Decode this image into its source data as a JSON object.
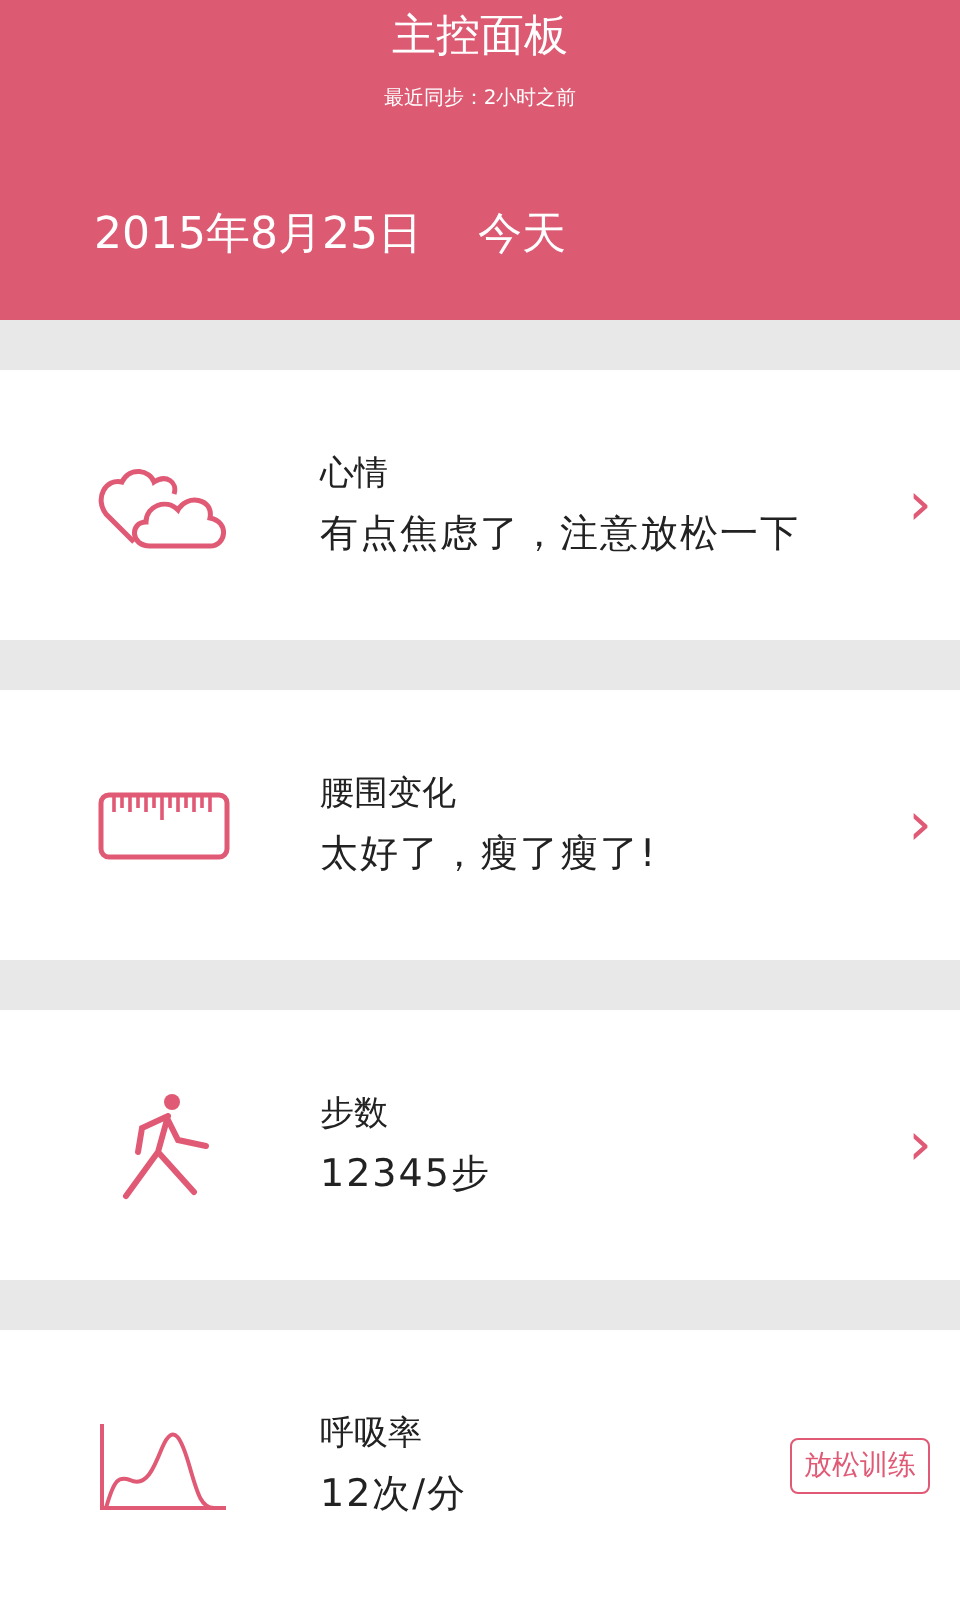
{
  "header": {
    "title": "主控面板",
    "sync": "最近同步：2小时之前",
    "date": "2015年8月25日",
    "day": "今天"
  },
  "cards": [
    {
      "title": "心情",
      "value": "有点焦虑了，注意放松一下",
      "kind": "arrow",
      "arrow": "›"
    },
    {
      "title": "腰围变化",
      "value": "太好了，瘦了瘦了!",
      "kind": "arrow",
      "arrow": "›"
    },
    {
      "title": "步数",
      "value": "12345步",
      "kind": "arrow",
      "arrow": "›"
    },
    {
      "title": "呼吸率",
      "value": "12次/分",
      "kind": "action",
      "action": "放松训练"
    }
  ]
}
